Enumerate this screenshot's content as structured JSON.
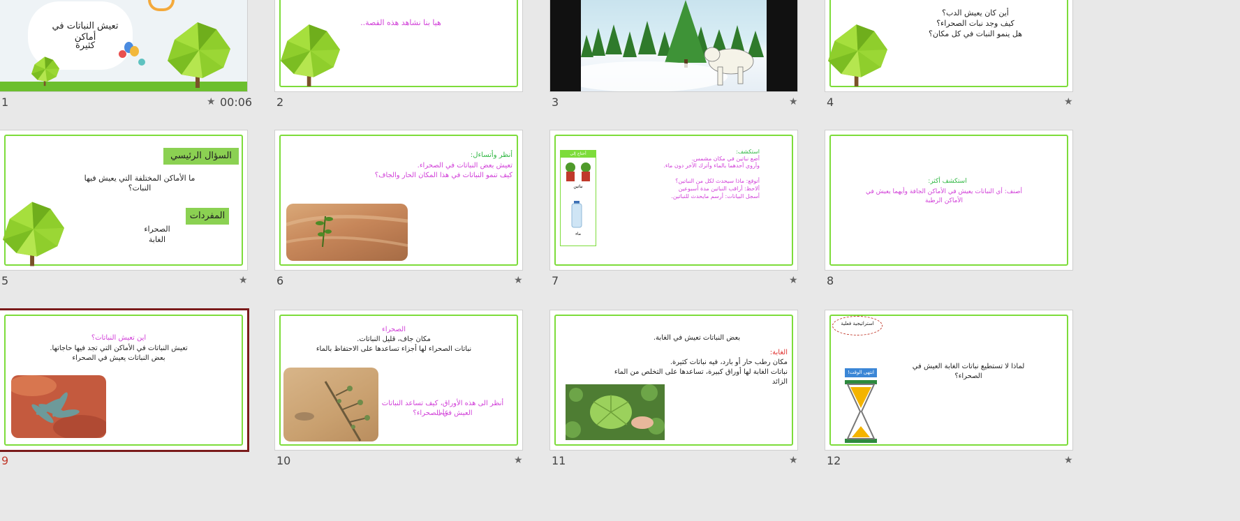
{
  "slides": [
    {
      "number": "1",
      "timing": "00:06",
      "text": [
        "تعيش النباتات في أماكن",
        "كثيرة"
      ]
    },
    {
      "number": "2",
      "text": [
        "هيا بنا نشاهد هذه القصة.."
      ]
    },
    {
      "number": "3"
    },
    {
      "number": "4",
      "text": [
        "أين كان يعيش الدب؟",
        "كيف وجد نبات الصحراء؟",
        "هل ينمو النبات في كل مكان؟"
      ]
    },
    {
      "number": "5",
      "box1": "السؤال الرئيسي",
      "question": [
        "ما الأماكن المختلفة التي يعيش فيها",
        "النبات؟"
      ],
      "box2": "المفردات",
      "vocab": [
        "الصحراء",
        "الغابة"
      ]
    },
    {
      "number": "6",
      "text": [
        "أنظر وأتساءل:",
        "تعيش بعض النباتات في الصحراء.",
        "كيف تنمو النباتات في هذا المكان الحار والجاف؟"
      ]
    },
    {
      "number": "7",
      "side_title": "أحتاج إلى",
      "side_labels": [
        "نباتين",
        "ماء"
      ],
      "text": [
        "استكشف:",
        "أضع نباتين في مكان مشمس.",
        "وأروي أحدهما بالماء وأترك الآخر دون ماء.",
        "أتوقع: ماذا سيحدث لكل من النباتين؟",
        "ألاحظ: أراقب النباتين مدة أسبوعين",
        "أسجل البيانات: أرسم مايحدث للنباتين."
      ]
    },
    {
      "number": "8",
      "text": [
        "استكشف أكثر:",
        "أصنف: أي النباتات يعيش في الأماكن الجافة وأيهما يعيش في",
        "الأماكن الرطبة"
      ]
    },
    {
      "number": "9",
      "text": [
        "اين تعيش النباتات؟",
        "تعيش النباتات في الأماكن التي تجد فيها حاجاتها.",
        "بعض النباتات يعيش في الصحراء"
      ]
    },
    {
      "number": "10",
      "text": [
        "الصحراء",
        "مكان جاف، قليل النباتات.",
        "نباتات الصحراء لها أجزاء تساعدها على الاحتفاظ بالماء"
      ],
      "caption": [
        "أنظر الى هذه الأوراق، كيف تساعد النباتات على",
        "العيش في الصحراء؟"
      ]
    },
    {
      "number": "11",
      "text": [
        "بعض النباتات تعيش في الغابة.",
        "الغابة:",
        "مكان رطب حار أو بارد، فيه نباتات كثيرة.",
        "نباتات الغابة لها أوراق كبيرة، تساعدها على التخلص من الماء",
        "الزائد"
      ]
    },
    {
      "number": "12",
      "badge": "استراتيجية فعلية",
      "timer_label": "انتهى الوقت!",
      "question": [
        "لماذا لا تستطيع نباتات الغابة العيش في",
        "الصحراء؟"
      ]
    }
  ],
  "colors": {
    "frame": "#7ddc3a",
    "pink": "#d13fd8",
    "green": "#2db640",
    "selected": "#7a1b1b"
  }
}
